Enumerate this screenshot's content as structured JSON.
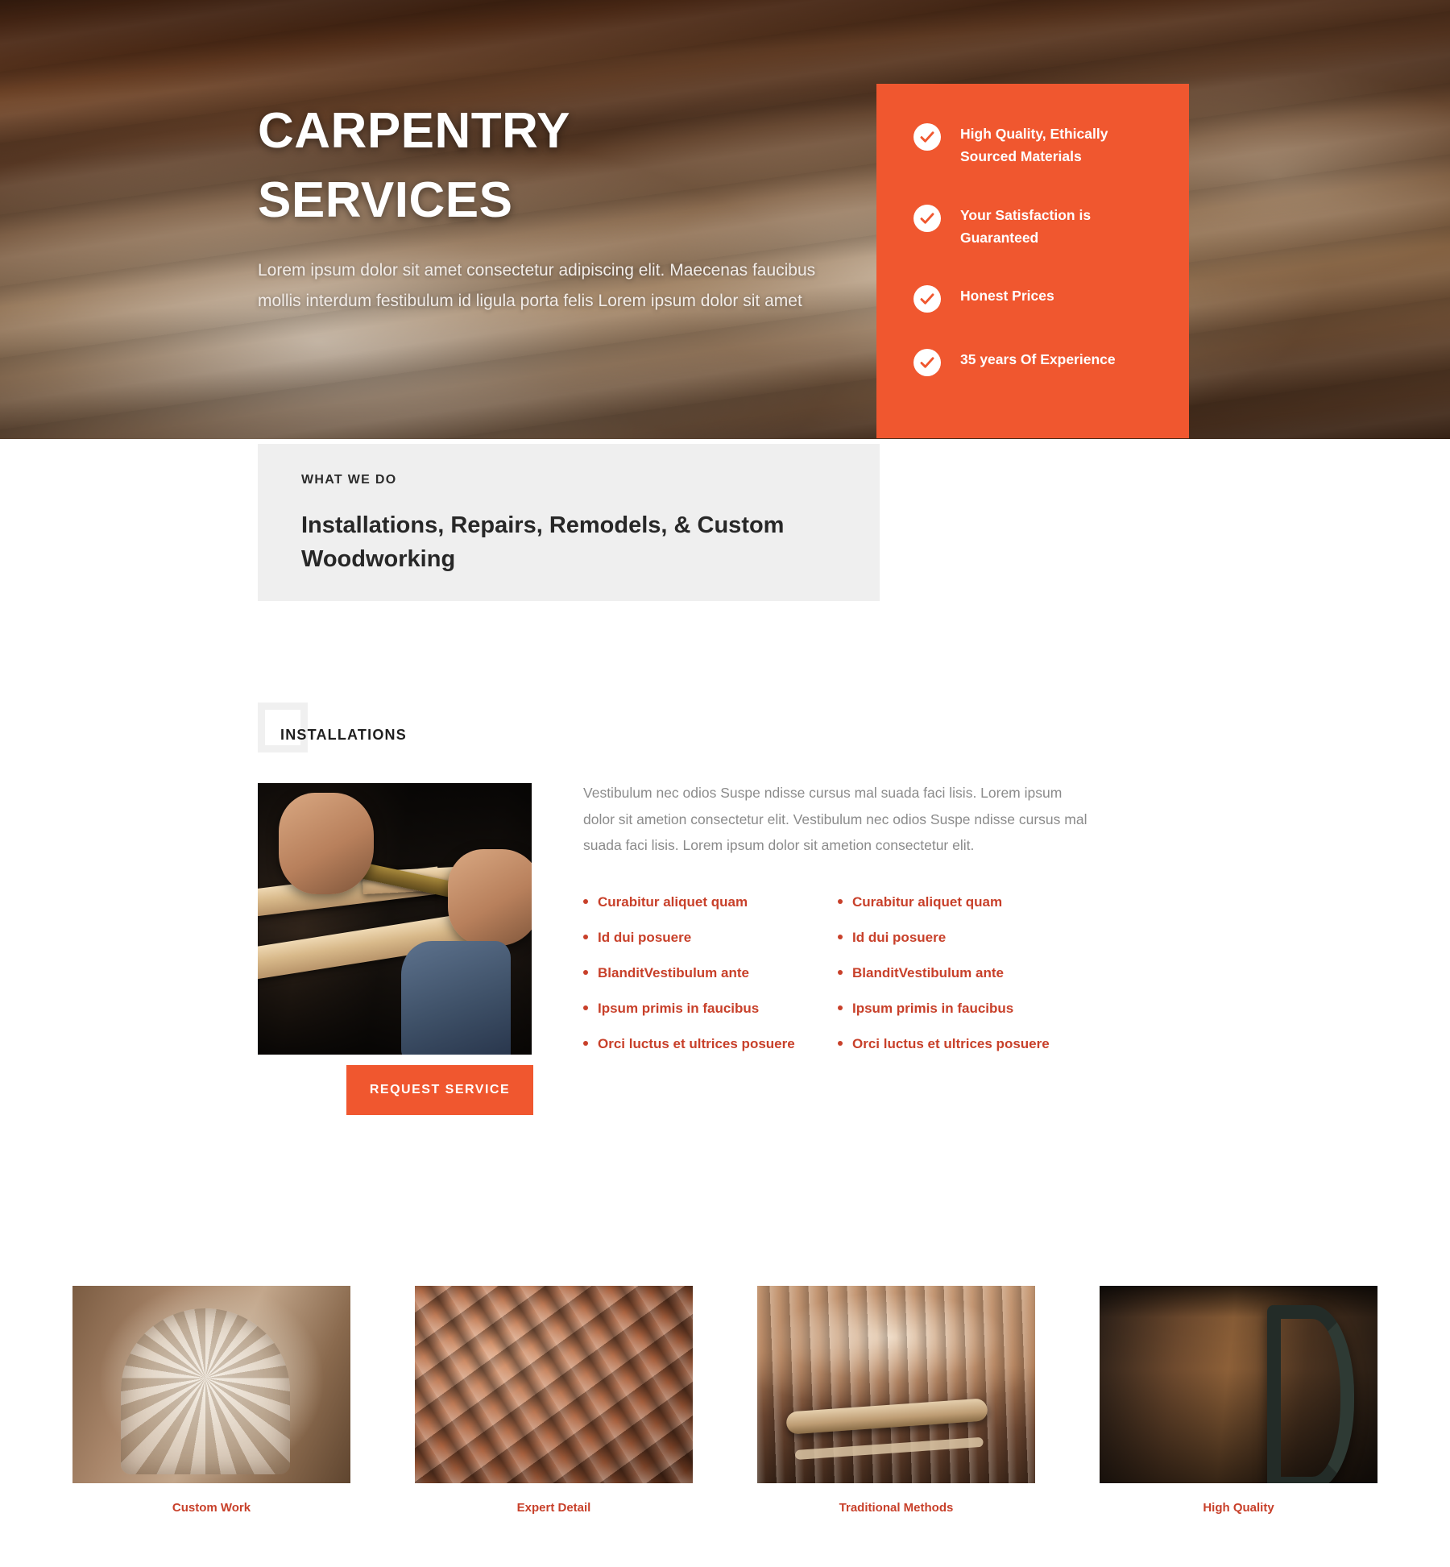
{
  "hero": {
    "title": "Carpentry Services",
    "subtitle": "Lorem ipsum dolor sit amet consectetur adipiscing elit. Maecenas faucibus mollis interdum festibulum id ligula porta felis Lorem ipsum dolor sit amet",
    "accent_color": "#f0572f",
    "features": [
      {
        "icon": "check-circle-icon",
        "label": "High Quality, Ethically Sourced Materials"
      },
      {
        "icon": "check-circle-icon",
        "label": "Your Satisfaction is Guaranteed"
      },
      {
        "icon": "check-circle-icon",
        "label": "Honest Prices"
      },
      {
        "icon": "check-circle-icon",
        "label": "35 years Of Experience"
      }
    ]
  },
  "what_we_do": {
    "kicker": "WHAT WE DO",
    "title": "Installations, Repairs, Remodels, & Custom Woodworking",
    "background_color": "#efefef"
  },
  "installations": {
    "heading": "INSTALLATIONS",
    "paragraph": "Vestibulum nec odios Suspe ndisse cursus mal suada faci lisis. Lorem ipsum dolor sit ametion consectetur elit. Vestibulum nec odios Suspe ndisse cursus mal suada faci lisis. Lorem ipsum dolor sit ametion consectetur elit.",
    "cta_label": "REQUEST SERVICE",
    "cta_color": "#f0572f",
    "photo_alt": "carpenter-measuring-wood-photo",
    "bullets_left": [
      "Curabitur aliquet quam",
      "Id dui posuere",
      "BlanditVestibulum ante",
      "Ipsum primis in faucibus",
      "Orci luctus et ultrices posuere"
    ],
    "bullets_right": [
      "Curabitur aliquet quam",
      "Id dui posuere",
      "BlanditVestibulum ante",
      "Ipsum primis in faucibus",
      "Orci luctus et ultrices posuere"
    ],
    "bullet_color": "#c8402a"
  },
  "gallery": {
    "items": [
      {
        "caption": "Custom Work",
        "photo_alt": "carved-wooden-chair-back-photo"
      },
      {
        "caption": "Expert Detail",
        "photo_alt": "ornate-wood-carving-closeup-photo"
      },
      {
        "caption": "Traditional Methods",
        "photo_alt": "hand-carving-with-chisels-photo"
      },
      {
        "caption": "High Quality",
        "photo_alt": "woodworking-clamp-on-bench-photo"
      }
    ],
    "caption_color": "#c8402a"
  }
}
